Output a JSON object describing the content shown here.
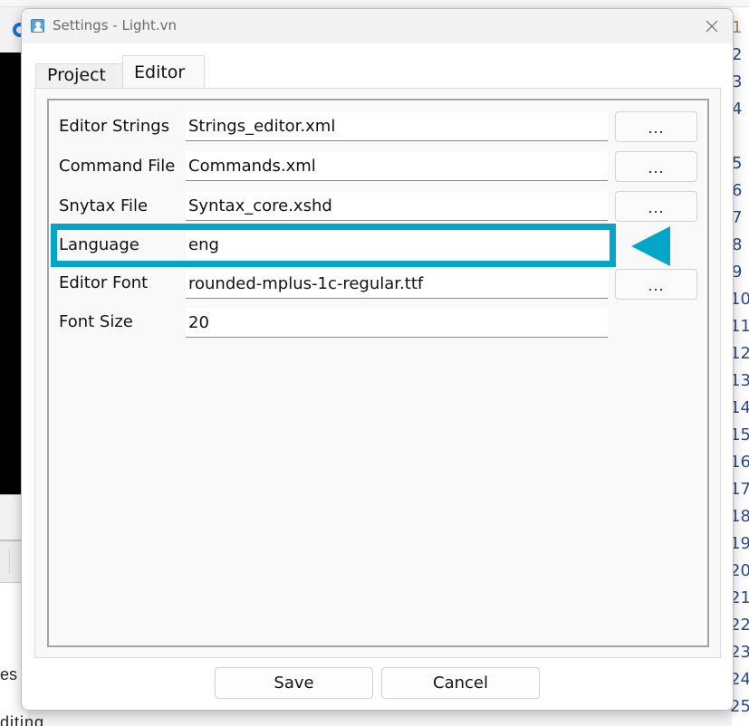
{
  "background": {
    "left_text_fragment_1": "es",
    "left_text_fragment_2": "diting",
    "line_numbers": [
      "1",
      "2",
      "3",
      "4",
      "5",
      "6",
      "7",
      "8",
      "9",
      "10",
      "11",
      "12",
      "13",
      "14",
      "15",
      "16",
      "17",
      "18",
      "19",
      "20",
      "21",
      "22",
      "23",
      "24",
      "25"
    ]
  },
  "dialog": {
    "title": "Settings - Light.vn",
    "close_icon": "close-icon",
    "tabs": [
      {
        "label": "Project",
        "active": false
      },
      {
        "label": "Editor",
        "active": true
      }
    ],
    "rows": [
      {
        "label": "Editor Strings",
        "value": "Strings_editor.xml",
        "browse_label": "..."
      },
      {
        "label": "Command File",
        "value": "Commands.xml",
        "browse_label": "..."
      },
      {
        "label": "Snytax File",
        "value": "Syntax_core.xshd",
        "browse_label": "..."
      },
      {
        "label": "Language",
        "value": "eng"
      },
      {
        "label": "Editor Font",
        "value": "rounded-mplus-1c-regular.ttf",
        "browse_label": "..."
      },
      {
        "label": "Font Size",
        "value": "20"
      }
    ],
    "buttons": {
      "save_label": "Save",
      "cancel_label": "Cancel"
    },
    "annotation": {
      "highlight_color": "#03a6c9",
      "highlighted_row": "Language",
      "indicator_icon": "left-arrow-icon"
    }
  }
}
